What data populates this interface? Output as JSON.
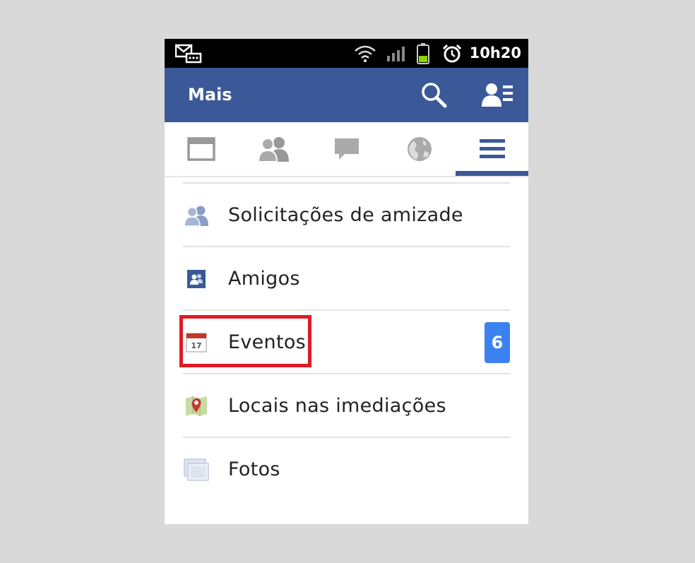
{
  "status_bar": {
    "time": "10h20",
    "icons": [
      "mail-notification-icon",
      "wifi-icon",
      "signal-icon",
      "battery-icon",
      "alarm-icon"
    ]
  },
  "header": {
    "title": "Mais",
    "buttons": [
      "search-icon",
      "friend-requests-icon"
    ],
    "color": "#3b5998"
  },
  "tabs": [
    {
      "name": "news-feed",
      "icon": "news-feed-icon",
      "active": false
    },
    {
      "name": "friends",
      "icon": "friends-icon",
      "active": false
    },
    {
      "name": "messages",
      "icon": "chat-bubble-icon",
      "active": false
    },
    {
      "name": "notifications",
      "icon": "globe-icon",
      "active": false
    },
    {
      "name": "more",
      "icon": "menu-icon",
      "active": true
    }
  ],
  "menu": {
    "items": [
      {
        "label": "Solicitações de amizade",
        "icon": "friend-requests-icon"
      },
      {
        "label": "Amigos",
        "icon": "friends-book-icon"
      },
      {
        "label": "Eventos",
        "icon": "calendar-icon",
        "badge": "6",
        "highlighted": true
      },
      {
        "label": "Locais nas imediações",
        "icon": "map-pin-icon"
      },
      {
        "label": "Fotos",
        "icon": "photos-icon"
      }
    ]
  },
  "colors": {
    "brand": "#3b5998",
    "badge": "#3b82f0",
    "highlight": "#e01b24"
  }
}
